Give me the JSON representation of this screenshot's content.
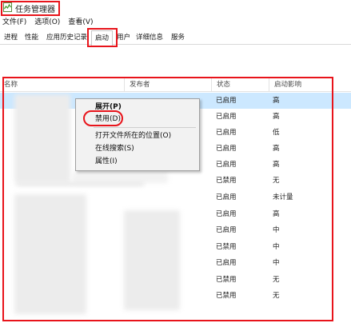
{
  "window": {
    "title": "任务管理器"
  },
  "menu": {
    "file": "文件(F)",
    "options": "选项(O)",
    "view": "查看(V)"
  },
  "tabs": [
    "进程",
    "性能",
    "应用历史记录",
    "启动",
    "用户",
    "详细信息",
    "服务"
  ],
  "columns": {
    "name": "名称",
    "publisher": "发布者",
    "status": "状态",
    "impact": "启动影响"
  },
  "rows": [
    {
      "status": "已启用",
      "impact": "高"
    },
    {
      "status": "已启用",
      "impact": "高"
    },
    {
      "status": "已启用",
      "impact": "低"
    },
    {
      "status": "已启用",
      "impact": "高"
    },
    {
      "status": "已启用",
      "impact": "高"
    },
    {
      "status": "已禁用",
      "impact": "无"
    },
    {
      "status": "已启用",
      "impact": "未计量"
    },
    {
      "status": "已启用",
      "impact": "高"
    },
    {
      "status": "已启用",
      "impact": "中"
    },
    {
      "status": "已禁用",
      "impact": "中"
    },
    {
      "status": "已启用",
      "impact": "中"
    },
    {
      "status": "已禁用",
      "impact": "无"
    },
    {
      "status": "已禁用",
      "impact": "无"
    }
  ],
  "context_menu": {
    "expand": "展开(P)",
    "disable": "禁用(D)",
    "open_location": "打开文件所在的位置(O)",
    "search_online": "在线搜索(S)",
    "properties": "属性(I)"
  },
  "colors": {
    "highlight": "#e8141b",
    "selected_row": "#cce8ff"
  }
}
